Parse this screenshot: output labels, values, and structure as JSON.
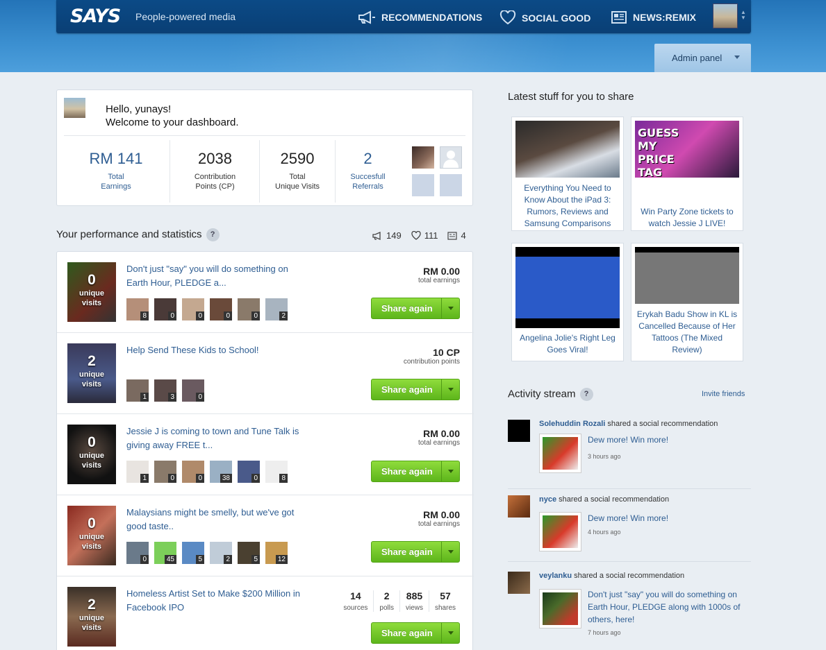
{
  "header": {
    "logo": "SAYS",
    "tagline": "People-powered media",
    "nav": [
      {
        "label": "RECOMMENDATIONS",
        "icon": "megaphone-icon"
      },
      {
        "label": "SOCIAL GOOD",
        "icon": "heart-icon"
      },
      {
        "label": "NEWS:REMIX",
        "icon": "newspaper-icon"
      }
    ],
    "admin_label": "Admin panel"
  },
  "welcome": {
    "greeting": "Hello, yunays!",
    "subtitle": "Welcome to your dashboard.",
    "stats": [
      {
        "value": "RM 141",
        "label1": "Total",
        "label2": "Earnings"
      },
      {
        "value": "2038",
        "label1": "Contribution",
        "label2": "Points (CP)"
      },
      {
        "value": "2590",
        "label1": "Total",
        "label2": "Unique Visits"
      },
      {
        "value": "2",
        "label1": "Succesfull",
        "label2": "Referrals"
      }
    ]
  },
  "performance": {
    "title": "Your performance and statistics",
    "help": "?",
    "counts": {
      "recommendations": "149",
      "social_good": "111",
      "news": "4"
    },
    "share_label": "Share again",
    "unique_label1": "unique",
    "unique_label2": "visits",
    "items": [
      {
        "visits": "0",
        "title": "Don't just \"say\" you will do something on Earth Hour, PLEDGE a...",
        "earn_value": "RM 0.00",
        "earn_label": "total earnings",
        "avatars": [
          "8",
          "0",
          "0",
          "0",
          "0",
          "2"
        ]
      },
      {
        "visits": "2",
        "title": "Help Send These Kids to School!",
        "earn_value": "10 CP",
        "earn_label": "contribution points",
        "avatars": [
          "1",
          "3",
          "0"
        ]
      },
      {
        "visits": "0",
        "title": "Jessie J is coming to town and Tune Talk is giving away FREE t...",
        "earn_value": "RM 0.00",
        "earn_label": "total earnings",
        "avatars": [
          "1",
          "0",
          "0",
          "38",
          "0",
          "8"
        ]
      },
      {
        "visits": "0",
        "title": "Malaysians might be smelly, but we've got good taste..",
        "earn_value": "RM 0.00",
        "earn_label": "total earnings",
        "avatars": [
          "0",
          "45",
          "5",
          "2",
          "5",
          "12"
        ]
      },
      {
        "visits": "2",
        "title": "Homeless Artist Set to Make $200 Million in Facebook IPO",
        "stats": [
          {
            "v": "14",
            "l": "sources"
          },
          {
            "v": "2",
            "l": "polls"
          },
          {
            "v": "885",
            "l": "views"
          },
          {
            "v": "57",
            "l": "shares"
          }
        ]
      }
    ]
  },
  "latest": {
    "title": "Latest stuff for you to share",
    "items": [
      {
        "title": "Everything You Need to Know About the iPad 3: Rumors, Reviews and Samsung Comparisons"
      },
      {
        "title": "Win Party Zone tickets to watch Jessie J LIVE!",
        "overlay": "GUESS MY PRICE TAG"
      },
      {
        "title": "Angelina Jolie's Right Leg Goes Viral!"
      },
      {
        "title": "Erykah Badu Show in KL is Cancelled Because of Her Tattoos (The Mixed Review)"
      }
    ]
  },
  "activity": {
    "title": "Activity stream",
    "help": "?",
    "invite": "Invite friends",
    "items": [
      {
        "user": "Solehuddin Rozali",
        "action": "shared a social recommendation",
        "title": "Dew more! Win more!",
        "time": "3 hours ago"
      },
      {
        "user": "nyce",
        "action": "shared a social recommendation",
        "title": "Dew more! Win more!",
        "time": "4 hours ago"
      },
      {
        "user": "veylanku",
        "action": "shared a social recommendation",
        "title": "Don't just \"say\" you will do something on Earth Hour, PLEDGE along with 1000s of others, here!",
        "time": "7 hours ago"
      }
    ]
  },
  "colors": {
    "accent": "#2e5d92",
    "share_green": "#6cc326",
    "header_blue": "#0a3f75"
  }
}
